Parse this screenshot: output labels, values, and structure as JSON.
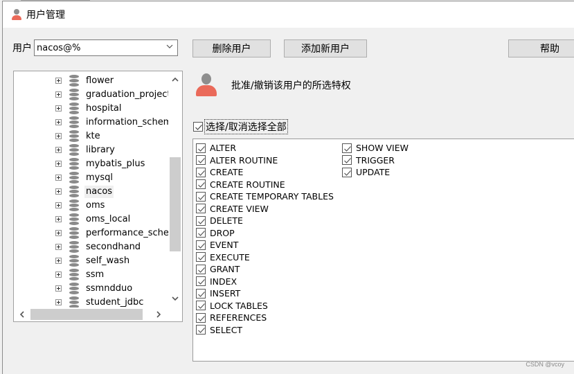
{
  "window": {
    "title": "用户管理",
    "icon": "user-icon"
  },
  "user_selector": {
    "label": "用户",
    "value": "nacos@%",
    "icon": "chevron-down-icon"
  },
  "toolbar": {
    "delete_label": "删除用户",
    "add_label": "添加新用户",
    "help_label": "帮助"
  },
  "database_tree": {
    "selected": "nacos",
    "items": [
      {
        "label": "flower"
      },
      {
        "label": "graduation_project"
      },
      {
        "label": "hospital"
      },
      {
        "label": "information_schema"
      },
      {
        "label": "kte"
      },
      {
        "label": "library"
      },
      {
        "label": "mybatis_plus"
      },
      {
        "label": "mysql"
      },
      {
        "label": "nacos"
      },
      {
        "label": "oms"
      },
      {
        "label": "oms_local"
      },
      {
        "label": "performance_schema"
      },
      {
        "label": "secondhand"
      },
      {
        "label": "self_wash"
      },
      {
        "label": "ssm"
      },
      {
        "label": "ssmndduo"
      },
      {
        "label": "student_jdbc"
      }
    ]
  },
  "privileges": {
    "heading": "批准/撤销该用户的所选特权",
    "select_all_label": "选择/取消选择全部",
    "select_all_checked": true,
    "column1": [
      {
        "label": "ALTER",
        "checked": true
      },
      {
        "label": "ALTER ROUTINE",
        "checked": true
      },
      {
        "label": "CREATE",
        "checked": true
      },
      {
        "label": "CREATE ROUTINE",
        "checked": true
      },
      {
        "label": "CREATE TEMPORARY TABLES",
        "checked": true
      },
      {
        "label": "CREATE VIEW",
        "checked": true
      },
      {
        "label": "DELETE",
        "checked": true
      },
      {
        "label": "DROP",
        "checked": true
      },
      {
        "label": "EVENT",
        "checked": true
      },
      {
        "label": "EXECUTE",
        "checked": true
      },
      {
        "label": "GRANT",
        "checked": true
      },
      {
        "label": "INDEX",
        "checked": true
      },
      {
        "label": "INSERT",
        "checked": true
      },
      {
        "label": "LOCK TABLES",
        "checked": true
      },
      {
        "label": "REFERENCES",
        "checked": true
      },
      {
        "label": "SELECT",
        "checked": true
      }
    ],
    "column2": [
      {
        "label": "SHOW VIEW",
        "checked": true
      },
      {
        "label": "TRIGGER",
        "checked": true
      },
      {
        "label": "UPDATE",
        "checked": true
      }
    ]
  },
  "watermark": "CSDN @vcoy"
}
